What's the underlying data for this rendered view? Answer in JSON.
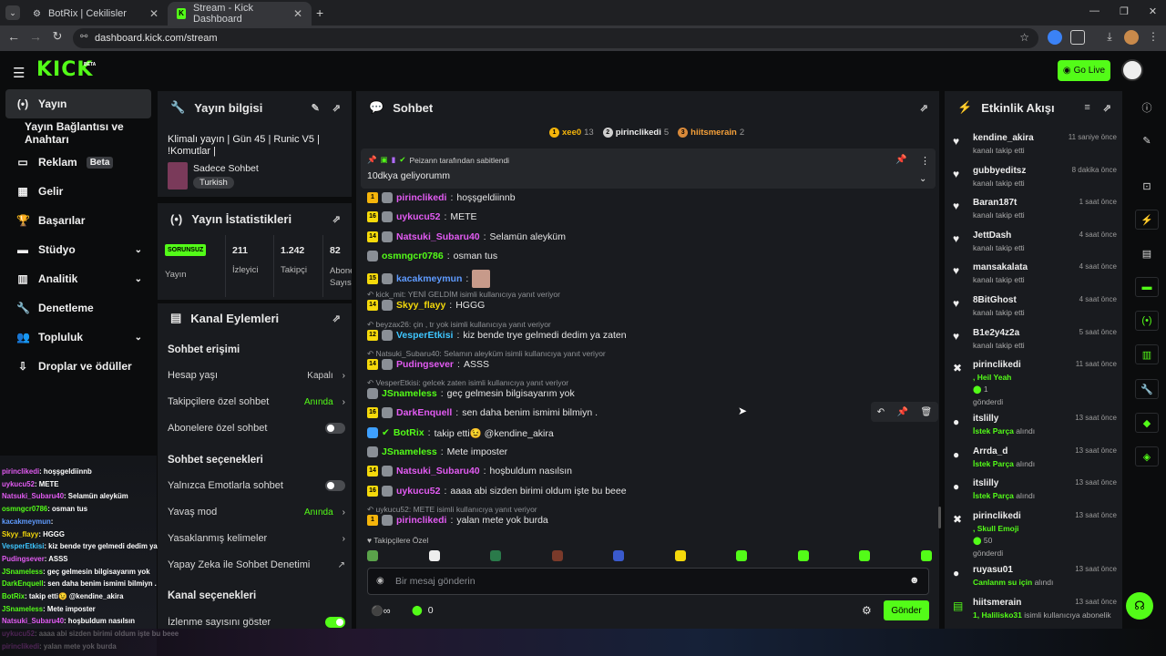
{
  "browser": {
    "tabs": [
      {
        "label": "BotRix | Cekilisler"
      },
      {
        "label": "Stream - Kick Dashboard"
      }
    ],
    "url": "dashboard.kick.com/stream",
    "new_tab": "+"
  },
  "header": {
    "logo": "KICK",
    "logo_badge": "BETA",
    "go_live": "Go Live"
  },
  "sidebar": {
    "items": [
      {
        "label": "Yayın",
        "icon": "broadcast-icon"
      },
      {
        "label": "Yayın Bağlantısı ve Anahtarı"
      },
      {
        "label": "Reklam",
        "badge": "Beta",
        "icon": "ad-icon"
      },
      {
        "label": "Gelir",
        "icon": "revenue-icon"
      },
      {
        "label": "Başarılar",
        "icon": "trophy-icon"
      },
      {
        "label": "Stüdyo",
        "icon": "studio-icon"
      },
      {
        "label": "Analitik",
        "icon": "chart-icon"
      },
      {
        "label": "Denetleme",
        "icon": "wrench-icon"
      },
      {
        "label": "Topluluk",
        "icon": "people-icon"
      },
      {
        "label": "Droplar ve ödüller",
        "icon": "drop-icon"
      }
    ]
  },
  "stream_info": {
    "title": "Yayın bilgisi",
    "stream_title": "Klimalı yayın | Gün 45 | Runic V5 | !Komutlar |",
    "category": "Sadece Sohbet",
    "tag": "Turkish"
  },
  "stats": {
    "title": "Yayın İstatistikleri",
    "duration": "SORUNSUZ",
    "duration_label": "Yayın",
    "viewers": "211",
    "viewers_label": "İzleyici",
    "followers": "1.242",
    "followers_label": "Takipçi",
    "subs": "82",
    "subs_label": "Abone Sayısı"
  },
  "channel_actions": {
    "title": "Kanal Eylemleri",
    "sec1": "Sohbet erişimi",
    "account_age": "Hesap yaşı",
    "account_age_val": "Kapalı",
    "followers_only": "Takipçilere özel sohbet",
    "followers_only_val": "Anında",
    "subs_only": "Abonelere özel sohbet",
    "sec2": "Sohbet seçenekleri",
    "emote_only": "Yalnızca Emotlarla sohbet",
    "slow_mode": "Yavaş mod",
    "slow_mode_val": "Anında",
    "banned_words": "Yasaklanmış kelimeler",
    "ai_mod": "Yapay Zeka ile Sohbet Denetimi",
    "sec3": "Kanal seçenekleri",
    "show_viewers": "İzlenme sayısını göster"
  },
  "chat": {
    "title": "Sohbet",
    "leaders": [
      {
        "name": "xee0",
        "count": "13",
        "rank": "1"
      },
      {
        "name": "pirinclikedi",
        "count": "5",
        "rank": "2"
      },
      {
        "name": "hiitsmerain",
        "count": "2",
        "rank": "3"
      }
    ],
    "pinned_by": "Peizann tarafından sabitlendi",
    "pinned_msg": "10dkya geliyorumm",
    "messages": [
      {
        "lvl": "1",
        "c": "#f5b50b",
        "u": "pirinclikedi",
        "uc": "#e25bf2",
        "t": "hoşşgeldiinnb"
      },
      {
        "lvl": "16",
        "c": "#f5d90b",
        "u": "uykucu52",
        "uc": "#e25bf2",
        "t": "METE"
      },
      {
        "lvl": "14",
        "c": "#f5d90b",
        "u": "Natsuki_Subaru40",
        "uc": "#e25bf2",
        "t": "Selamün aleyküm"
      },
      {
        "lvl": "",
        "c": "",
        "u": "osmngcr0786",
        "uc": "#53fc18",
        "t": "osman tus"
      },
      {
        "lvl": "15",
        "c": "#f5d90b",
        "u": "kacakmeymun",
        "uc": "#5f9bff",
        "t": ""
      },
      {
        "reply": "kick_mit: YENİ GELDİM isimli kullanıcıya yanıt veriyor"
      },
      {
        "lvl": "14",
        "c": "#f5d90b",
        "u": "Skyy_flayy",
        "uc": "#f5d90b",
        "t": "HGGG"
      },
      {
        "reply": "beyzax26: çin , tr yok isimli kullanıcıya yanıt veriyor"
      },
      {
        "lvl": "12",
        "c": "#f5d90b",
        "u": "VesperEtkisi",
        "uc": "#3ec6ff",
        "t": "kiz bende trye gelmedi dedim ya zaten"
      },
      {
        "reply": "Natsuki_Subaru40: Selamın aleyküm isimli kullanıcıya yanıt veriyor"
      },
      {
        "lvl": "14",
        "c": "#f5d90b",
        "u": "Pudingsever",
        "uc": "#e25bf2",
        "t": "ASSS"
      },
      {
        "reply": "VesperEtkisi: gelcek zaten isimli kullanıcıya yanıt veriyor"
      },
      {
        "lvl": "",
        "c": "",
        "u": "JSnameless",
        "uc": "#53fc18",
        "t": "geç gelmesin bilgisayarım yok"
      },
      {
        "lvl": "16",
        "c": "#f5d90b",
        "u": "DarkEnquell",
        "uc": "#e25bf2",
        "t": "sen daha benim ismimi bilmiyn ."
      },
      {
        "lvl": "",
        "c": "",
        "u": "BotRix",
        "uc": "#53fc18",
        "t": "takip etti😉 @kendine_akira"
      },
      {
        "lvl": "",
        "c": "",
        "u": "JSnameless",
        "uc": "#53fc18",
        "t": "Mete imposter"
      },
      {
        "lvl": "14",
        "c": "#f5d90b",
        "u": "Natsuki_Subaru40",
        "uc": "#e25bf2",
        "t": "hoşbuldum nasılsın"
      },
      {
        "lvl": "16",
        "c": "#f5d90b",
        "u": "uykucu52",
        "uc": "#e25bf2",
        "t": "aaaa abi sizden birimi oldum işte bu beee"
      },
      {
        "reply": "uykucu52: METE isimli kullanıcıya yanıt veriyor"
      },
      {
        "lvl": "1",
        "c": "#f5b50b",
        "u": "pirinclikedi",
        "uc": "#e25bf2",
        "t": "yalan mete yok burda"
      }
    ],
    "emote_section": "Takipçilere Özel",
    "input_placeholder": "Bir mesaj gönderin",
    "points": "0",
    "send": "Gönder"
  },
  "activity": {
    "title": "Etkinlik Akışı",
    "items": [
      {
        "n": "kendine_akira",
        "s": "kanalı takip etti",
        "t": "11 saniye önce",
        "ic": "♥"
      },
      {
        "n": "gubbyeditsz",
        "s": "kanalı takip etti",
        "t": "8 dakika önce",
        "ic": "♥"
      },
      {
        "n": "Baran187t",
        "s": "kanalı takip etti",
        "t": "1 saat önce",
        "ic": "♥"
      },
      {
        "n": "JettDash",
        "s": "kanalı takip etti",
        "t": "4 saat önce",
        "ic": "♥"
      },
      {
        "n": "mansakalata",
        "s": "kanalı takip etti",
        "t": "4 saat önce",
        "ic": "♥"
      },
      {
        "n": "8BitGhost",
        "s": "kanalı takip etti",
        "t": "4 saat önce",
        "ic": "♥"
      },
      {
        "n": "B1e2y4z2a",
        "s": "kanalı takip etti",
        "t": "5 saat önce",
        "ic": "♥"
      },
      {
        "n": "pirinclikedi",
        "s": ", Heil Yeah",
        "s2": "1",
        "s3": "gönderdi",
        "t": "11 saat önce",
        "ic": "✖"
      },
      {
        "n": "itslilly",
        "s": "İstek Parça",
        "s4": "alındı",
        "t": "13 saat önce",
        "ic": "●"
      },
      {
        "n": "Arrda_d",
        "s": "İstek Parça",
        "s4": "alındı",
        "t": "13 saat önce",
        "ic": "●"
      },
      {
        "n": "itslilly",
        "s": "İstek Parça",
        "s4": "alındı",
        "t": "13 saat önce",
        "ic": "●"
      },
      {
        "n": "pirinclikedi",
        "s": ", Skull Emoji",
        "s2": "50",
        "s3": "gönderdi",
        "t": "13 saat önce",
        "ic": "✖"
      },
      {
        "n": "ruyasu01",
        "s": "Canlanm su için",
        "s4": "alındı",
        "t": "13 saat önce",
        "ic": "●"
      },
      {
        "n": "hiitsmerain",
        "s": "1, Halilisko31",
        "s4": "isimli kullanıcıya abonelik",
        "t": "13 saat önce",
        "ic": "▤"
      }
    ]
  },
  "overlay": [
    {
      "u": "pirinclikedi",
      "uc": "#e25bf2",
      "t": ": hoşşgeldiinnb"
    },
    {
      "u": "uykucu52",
      "uc": "#e25bf2",
      "t": ": METE"
    },
    {
      "u": "Natsuki_Subaru40",
      "uc": "#e25bf2",
      "t": ": Selamün aleyküm"
    },
    {
      "u": "osmngcr0786",
      "uc": "#53fc18",
      "t": ": osman tus"
    },
    {
      "u": "kacakmeymun",
      "uc": "#5f9bff",
      "t": ":"
    },
    {
      "u": "Skyy_flayy",
      "uc": "#f5d90b",
      "t": ": HGGG"
    },
    {
      "u": "VesperEtkisi",
      "uc": "#3ec6ff",
      "t": ": kiz bende trye gelmedi dedim ya zaten"
    },
    {
      "u": "Pudingsever",
      "uc": "#e25bf2",
      "t": ": ASSS"
    },
    {
      "u": "JSnameless",
      "uc": "#53fc18",
      "t": ": geç gelmesin bilgisayarım yok"
    },
    {
      "u": "DarkEnquell",
      "uc": "#53fc18",
      "t": ": sen daha benim ismimi bilmiyn ."
    },
    {
      "u": "BotRix",
      "uc": "#53fc18",
      "t": ": takip etti😉 @kendine_akira"
    },
    {
      "u": "JSnameless",
      "uc": "#53fc18",
      "t": ": Mete imposter"
    },
    {
      "u": "Natsuki_Subaru40",
      "uc": "#e25bf2",
      "t": ": hoşbuldum nasılsın"
    },
    {
      "u": "uykucu52",
      "uc": "#e25bf2",
      "t": ": aaaa abi sizden birimi oldum işte bu beee"
    },
    {
      "u": "pirinclikedi",
      "uc": "#e25bf2",
      "t": ": yalan mete yok burda"
    }
  ],
  "colors": {
    "accent": "#53fc18",
    "panel": "#191b1f",
    "bg": "#0b0c0d"
  }
}
